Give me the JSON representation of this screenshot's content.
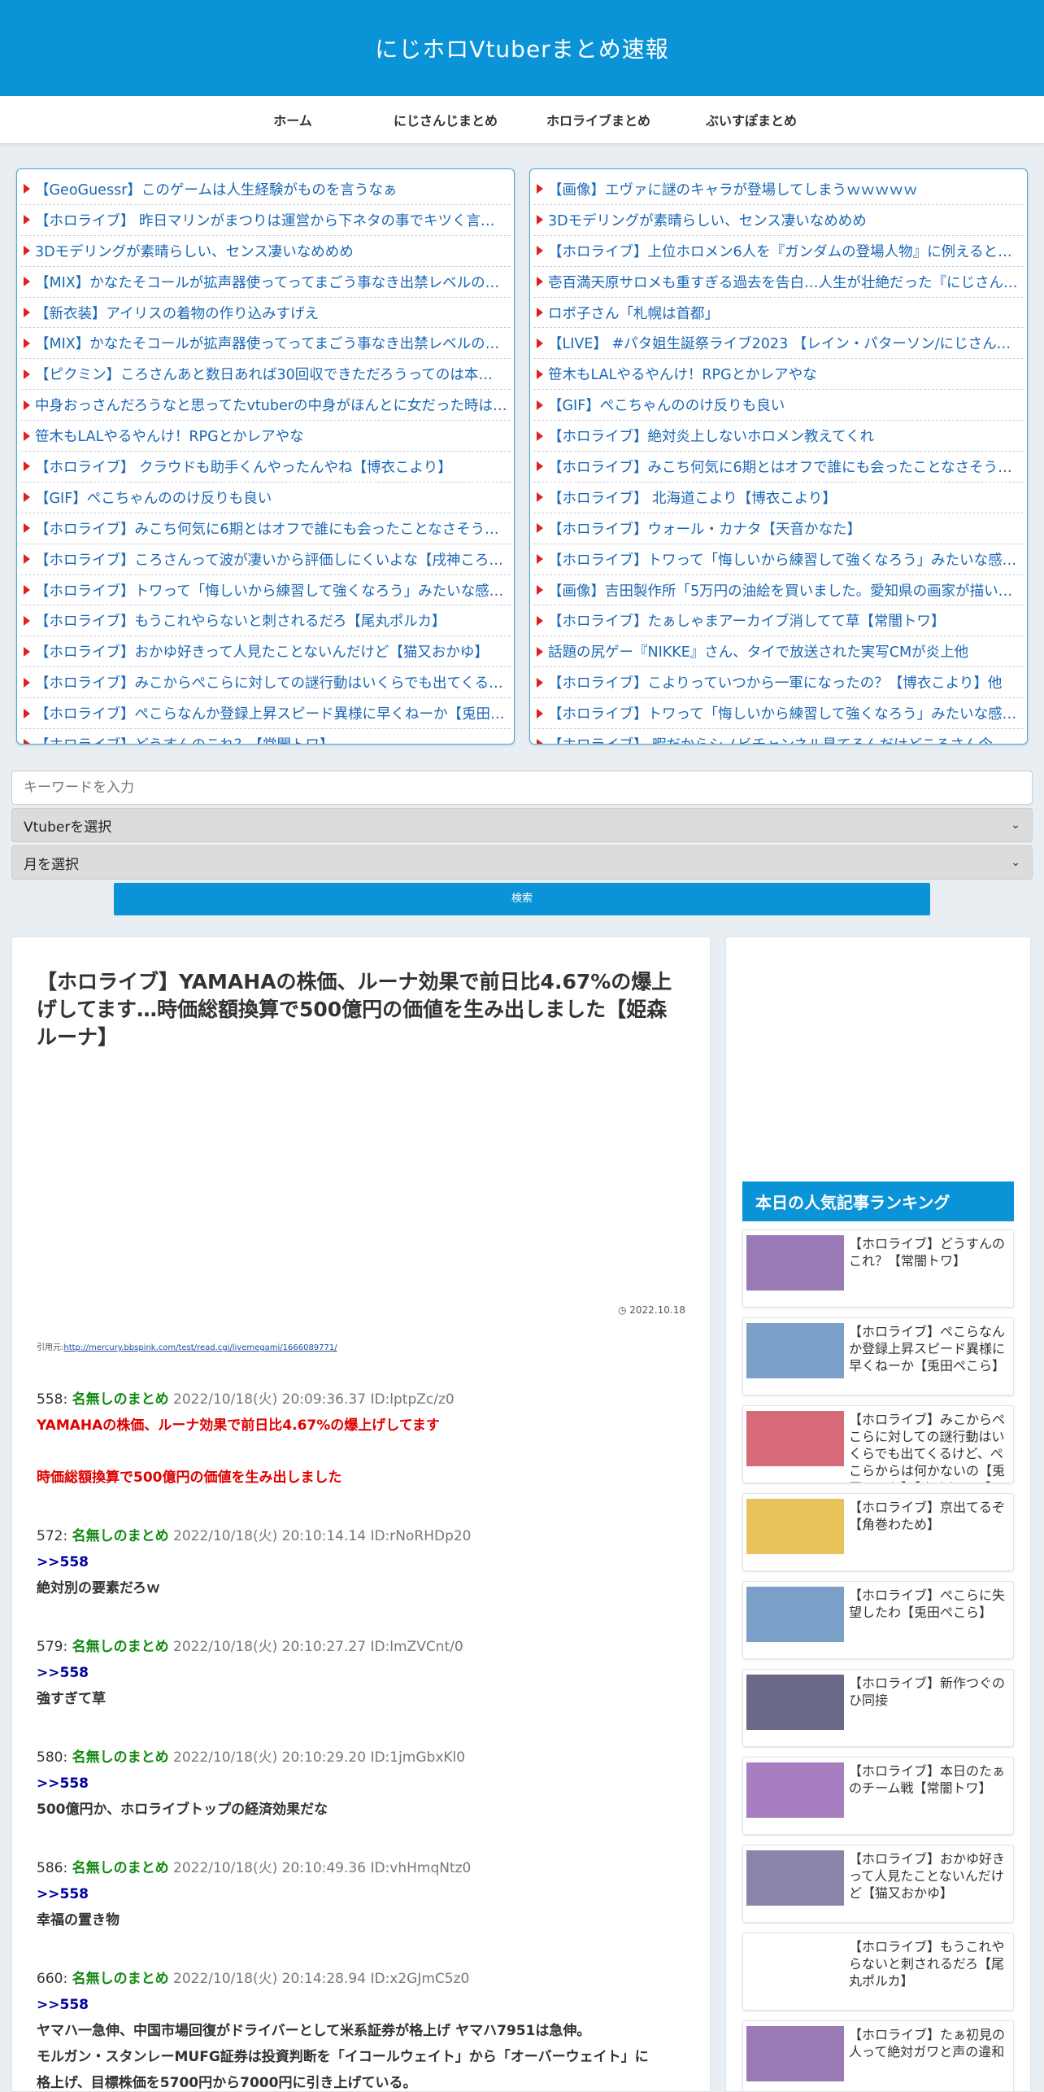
{
  "site": {
    "title": "にじホロVtuberまとめ速報"
  },
  "nav": [
    "ホーム",
    "にじさんじまとめ",
    "ホロライブまとめ",
    "ぶいすぽまとめ"
  ],
  "rss_left": [
    "【GeoGuessr】このゲームは人生経験がものを言うなぁ",
    "【ホロライブ】 昨日マリンがまつりは運営から下ネタの事でキツく言…",
    "3Dモデリングが素晴らしい、センス凄いなめめめ",
    "【MIX】かなたそコールが拡声器使ってってまごう事なき出禁レベルのう…",
    "【新衣装】アイリスの着物の作り込みすげえ",
    "【MIX】かなたそコールが拡声器使ってってまごう事なき出禁レベルのう…",
    "【ピクミン】ころさんあと数日あれば30回収できただろうってのは本…",
    "中身おっさんだろうなと思ってたvtuberの中身がほんとに女だった時は…",
    "笹木もLALやるやんけ！RPGとかレアやな",
    "【ホロライブ】 クラウドも助手くんやったんやね【博衣こより】",
    "【GIF】ぺこちゃんののけ反りも良い",
    "【ホロライブ】みこち何気に6期とはオフで誰にも会ったことなさそう…",
    "【ホロライブ】ころさんって波が凄いから評価しにくいよな【戌神ころ…",
    "【ホロライブ】トワって「悔しいから練習して強くなろう」みたいな感…",
    "【ホロライブ】もうこれやらないと刺されるだろ【尾丸ポルカ】",
    "【ホロライブ】おかゆ好きって人見たことないんだけど【猫又おかゆ】",
    "【ホロライブ】みこからぺこらに対しての謎行動はいくらでも出てくる…",
    "【ホロライブ】ぺこらなんか登録上昇スピード異様に早くねーか【兎田…",
    "【ホロライブ】どうすんのこれ？【常闇トワ】"
  ],
  "rss_right": [
    "【画像】エヴァに謎のキャラが登場してしまうｗｗｗｗｗ",
    "3Dモデリングが素晴らしい、センス凄いなめめめ",
    "【ホロライブ】上位ホロメン6人を『ガンダムの登場人物』に例えると…",
    "壱百満天原サロメも重すぎる過去を告白…人生が壮絶だった『にじさん…",
    "ロボ子さん「札幌は首都」",
    "【LIVE】 #パタ姐生誕祭ライブ2023 【レイン・パターソン/にじさんじ…",
    "笹木もLALやるやんけ！RPGとかレアやな",
    "【GIF】ぺこちゃんののけ反りも良い",
    "【ホロライブ】絶対炎上しないホロメン教えてくれ",
    "【ホロライブ】みこち何気に6期とはオフで誰にも会ったことなさそう…",
    "【ホロライブ】 北海道こより【博衣こより】",
    "【ホロライブ】ウォール・カナタ【天音かなた】",
    "【ホロライブ】トワって「悔しいから練習して強くなろう」みたいな感…",
    "【画像】吉田製作所「5万円の油絵を買いました。愛知県の画家が描い…",
    "【ホロライブ】たぁしゃまアーカイブ消してて草【常闇トワ】",
    "話題の尻ゲー『NIKKE』さん、タイで放送された実写CMが炎上他",
    "【ホロライブ】こよりっていつから一軍になったの？【博衣こより】他",
    "【ホロライブ】トワって「悔しいから練習して強くなろう」みたいな感…",
    "【ホロライブ】 暇だからシノビチャンネル見てるんだけどころさん今…"
  ],
  "search": {
    "placeholder": "キーワードを入力",
    "vtuber_select": "Vtuberを選択",
    "month_select": "月を選択",
    "button": "検索"
  },
  "article": {
    "title": "【ホロライブ】YAMAHAの株価、ルーナ効果で前日比4.67%の爆上げしてます…時価総額換算で500億円の価値を生み出しました【姫森ルーナ】",
    "date": "2022.10.18",
    "cite_label": "引用元:",
    "cite_url": "http://mercury.bbspink.com/test/read.cgi/livemegami/1666089771/",
    "posts": [
      {
        "num": "558:",
        "name": "名無しのまとめ",
        "meta": "2022/10/18(火) 20:09:36.37 ID:lptpZc/z0",
        "anchor": "",
        "lines": [
          "YAMAHAの株価、ルーナ効果で前日比4.67%の爆上げしてます",
          "",
          "時価総額換算で500億円の価値を生み出しました"
        ],
        "red": true
      },
      {
        "num": "572:",
        "name": "名無しのまとめ",
        "meta": "2022/10/18(火) 20:10:14.14 ID:rNoRHDp20",
        "anchor": ">>558",
        "lines": [
          "絶対別の要素だろｗ"
        ],
        "red": false
      },
      {
        "num": "579:",
        "name": "名無しのまとめ",
        "meta": "2022/10/18(火) 20:10:27.27 ID:lmZVCnt/0",
        "anchor": ">>558",
        "lines": [
          "強すぎて草"
        ],
        "red": false
      },
      {
        "num": "580:",
        "name": "名無しのまとめ",
        "meta": "2022/10/18(火) 20:10:29.20 ID:1jmGbxKl0",
        "anchor": ">>558",
        "lines": [
          "500億円か、ホロライブトップの経済効果だな"
        ],
        "red": false
      },
      {
        "num": "586:",
        "name": "名無しのまとめ",
        "meta": "2022/10/18(火) 20:10:49.36 ID:vhHmqNtz0",
        "anchor": ">>558",
        "lines": [
          "幸福の置き物"
        ],
        "red": false
      },
      {
        "num": "660:",
        "name": "名無しのまとめ",
        "meta": "2022/10/18(火) 20:14:28.94 ID:x2GJmC5z0",
        "anchor": ">>558",
        "lines": [
          "ヤマハ一急伸、中国市場回復がドライバーとして米系証券が格上げ ヤマハ7951は急伸。",
          "モルガン・スタンレーMUFG証券は投資判断を「イコールウェイト」から「オーバーウェイト」に",
          "格上げ、目標株価を5700円から7000円に引き上げている。"
        ],
        "red": false
      }
    ]
  },
  "ranking": {
    "title": "本日の人気記事ランキング",
    "items": [
      {
        "title": "【ホロライブ】どうすんのこれ？【常闇トワ】",
        "thumb": "#9b7ab8"
      },
      {
        "title": "【ホロライブ】ぺこらなんか登録上昇スピード異様に早くねーか【兎田ぺこら】",
        "thumb": "#7aa0c8"
      },
      {
        "title": "【ホロライブ】みこからぺこらに対しての謎行動はいくらでも出てくるけど、ぺこらからは何かないの【兎田ぺこら】【さくらみこ】",
        "thumb": "#d66a78"
      },
      {
        "title": "【ホロライブ】京出てるぞ【角巻わため】",
        "thumb": "#e8c35a"
      },
      {
        "title": "【ホロライブ】ぺこらに失望したわ【兎田ぺこら】",
        "thumb": "#7aa0c8"
      },
      {
        "title": "【ホロライブ】新作つぐのひ同接",
        "thumb": "#6a6a88"
      },
      {
        "title": "【ホロライブ】本日のたぁのチーム戦【常闇トワ】",
        "thumb": "#a77ec0"
      },
      {
        "title": "【ホロライブ】おかゆ好きって人見たことないんだけど【猫又おかゆ】",
        "thumb": "#8c84a8"
      },
      {
        "title": "【ホロライブ】もうこれやらないと刺されるだろ【尾丸ポルカ】",
        "thumb": "#ffffff"
      },
      {
        "title": "【ホロライブ】たぁ初見の人って絶対ガワと声の違和",
        "thumb": "#9b7ab8"
      }
    ]
  }
}
